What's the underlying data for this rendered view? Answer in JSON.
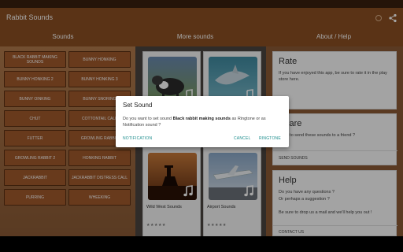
{
  "app": {
    "title": "Rabbit Sounds",
    "colors": {
      "appbar": "#8a4f22",
      "accent": "#1a8c8c"
    }
  },
  "tabs": [
    {
      "label": "Sounds"
    },
    {
      "label": "More sounds"
    },
    {
      "label": "About / Help"
    }
  ],
  "sound_buttons": [
    {
      "label": "BLACK RABBIT MAKING SOUNDS"
    },
    {
      "label": "BUNNY HONKING"
    },
    {
      "label": "BUNNY HONKING 2"
    },
    {
      "label": "BUNNY HONKING 3"
    },
    {
      "label": "BUNNY OINKING"
    },
    {
      "label": "BUNNY SNORING"
    },
    {
      "label": "CHUT"
    },
    {
      "label": "COTTONTAIL CALL"
    },
    {
      "label": "FUTTER"
    },
    {
      "label": "GROWLING RABBIT"
    },
    {
      "label": "GROWLING RABBIT 2"
    },
    {
      "label": "HONKING RABBIT"
    },
    {
      "label": "JACKRABBIT"
    },
    {
      "label": "JACKRABBIT DISTRESS CALL"
    },
    {
      "label": "PURRING"
    },
    {
      "label": "WHEEKING"
    }
  ],
  "more_sounds": [
    {
      "label": "",
      "image": "cow-image"
    },
    {
      "label": "",
      "image": "dolphin-image"
    },
    {
      "label": "Wild West Sounds",
      "image": "cowboy-image",
      "stars": "★★★★★"
    },
    {
      "label": "Airport Sounds",
      "image": "airplane-image",
      "stars": "★★★★★"
    }
  ],
  "about": {
    "rate": {
      "title": "Rate",
      "text": "If you have enjoyed this app, be sure to rate it in the play store here."
    },
    "share": {
      "title": "Share",
      "text": "Want to send these sounds to a friend ?",
      "action": "SEND SOUNDS"
    },
    "help": {
      "title": "Help",
      "line1": "Do you have any questions ?",
      "line2": "Or perhaps a suggestion ?",
      "line3": "Be sure to drop us a mail and we'll help you out !",
      "action": "CONTACT US"
    }
  },
  "dialog": {
    "title": "Set Sound",
    "message_prefix": "Do you want to set sound ",
    "sound_name": "Black rabbit making sounds",
    "message_suffix": " as Ringtone or as Notification sound ?",
    "btn_notification": "NOTIFICATION",
    "btn_cancel": "CANCEL",
    "btn_ringtone": "RINGTONE"
  }
}
